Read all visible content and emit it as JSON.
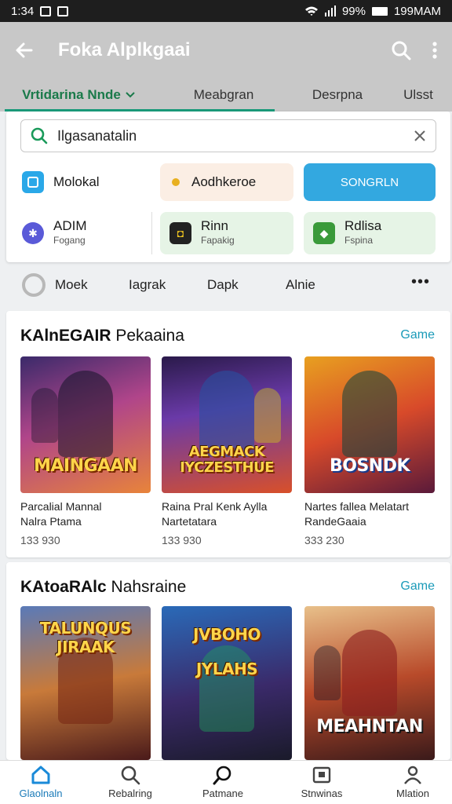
{
  "status_bar": {
    "time": "1:34",
    "battery": "99%",
    "clock": "199MAM"
  },
  "app_bar": {
    "title": "Foka Alplkgaai"
  },
  "tabs": [
    {
      "label": "Vrtidarina Nnde",
      "active": true
    },
    {
      "label": "Meabgran",
      "active": false
    },
    {
      "label": "Desrpna",
      "active": false
    },
    {
      "label": "Ulsst",
      "active": false
    }
  ],
  "search": {
    "value": "Ilgasanatalin"
  },
  "chips": {
    "molokal": {
      "label": "Molokal",
      "icon": "tablet-icon"
    },
    "addhkeroe": {
      "label": "Aodhkeroe",
      "icon": "coin-icon"
    },
    "songrln": {
      "label": "SONGRLN"
    },
    "adim": {
      "label": "ADIM",
      "sub": "Fogang",
      "icon": "puzzle-icon"
    },
    "rinn": {
      "label": "Rinn",
      "sub": "Fapakig",
      "icon": "gamepad-icon"
    },
    "rdlisa": {
      "label": "Rdlisa",
      "sub": "Fspina",
      "icon": "cube-icon"
    }
  },
  "filters": [
    "Moek",
    "Iagrak",
    "Dapk",
    "Alnie"
  ],
  "sections": [
    {
      "title_bold": "KAlnEGAIR",
      "title_rest": "Pekaaina",
      "link": "Game",
      "cards": [
        {
          "art_title": "MAINGAAN",
          "name_line1": "Parcalial Mannal",
          "name_line2": "Nalra Ptama",
          "count": "133 930"
        },
        {
          "art_title": "AEGMACK IYCZESTHUE",
          "name_line1": "Raina Pral Kenk Aylla",
          "name_line2": "Nartetatara",
          "count": "133 930"
        },
        {
          "art_title": "BOSNDK",
          "name_line1": "Nartes fallea Melatart",
          "name_line2": "RandeGaaia",
          "count": "333 230"
        }
      ]
    },
    {
      "title_bold": "KAtoaRAlc",
      "title_rest": "Nahsraine",
      "link": "Game",
      "cards": [
        {
          "art_title": "TALUNQUS JIRAAK"
        },
        {
          "art_title": "JVBOHO JYLAHS"
        },
        {
          "art_title": "MEAHNTAN"
        }
      ]
    }
  ],
  "bottom_nav": [
    {
      "label": "Glaolnaln",
      "icon": "home-icon",
      "active": true
    },
    {
      "label": "Rebalring",
      "icon": "search-icon",
      "active": false
    },
    {
      "label": "Patmane",
      "icon": "explore-icon",
      "active": false
    },
    {
      "label": "Stnwinas",
      "icon": "gallery-icon",
      "active": false
    },
    {
      "label": "Mlation",
      "icon": "person-icon",
      "active": false
    }
  ],
  "colors": {
    "accent": "#1a9a7a",
    "link": "#1a9ab8",
    "primary_button": "#33a8e0",
    "app_bar": "#c8c8c8"
  }
}
